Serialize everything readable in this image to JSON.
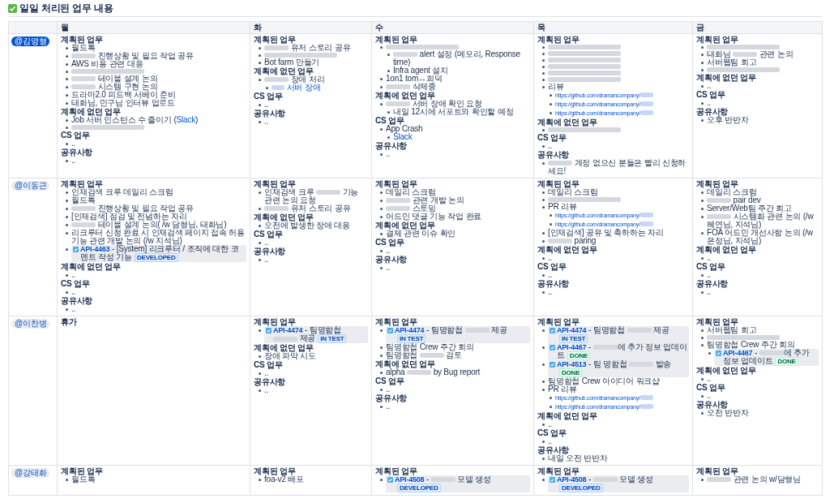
{
  "title": "일일 처리된 업무 내용",
  "columns": [
    "월",
    "화",
    "수",
    "목",
    "금"
  ],
  "rows": [
    {
      "user": {
        "name": "@김영형",
        "highlighted": true
      },
      "cells": [
        {
          "sections": [
            {
              "heading": "계획된 업무",
              "items": [
                {
                  "text": "월드톡"
                },
                {
                  "parts": [
                    {
                      "kind": "blur"
                    },
                    {
                      "kind": "text",
                      "text": " 진행상황 및 필요 작업 공유"
                    }
                  ]
                },
                {
                  "text": "AWS 비용 관련 대응"
                },
                {
                  "parts": [
                    {
                      "kind": "blur"
                    }
                  ]
                },
                {
                  "parts": [
                    {
                      "kind": "blur"
                    },
                    {
                      "kind": "text",
                      "text": " 테이블 설계 논의"
                    }
                  ]
                },
                {
                  "parts": [
                    {
                      "kind": "blur"
                    },
                    {
                      "kind": "text",
                      "text": " 시스템 구현 논의"
                    }
                  ]
                },
                {
                  "text": "드라마2.0 피드백 서베이 준비"
                },
                {
                  "text": "태화님, 민구님 인터뷰 업로드"
                }
              ]
            },
            {
              "heading": "계획에 없던 업무",
              "items": [
                {
                  "parts": [
                    {
                      "kind": "text",
                      "text": "Job 서버 인스턴스 수 줄이기 ("
                    },
                    {
                      "kind": "link",
                      "text": "Slack"
                    },
                    {
                      "kind": "text",
                      "text": ")"
                    }
                  ]
                },
                {
                  "parts": [
                    {
                      "kind": "blur"
                    }
                  ]
                }
              ]
            },
            {
              "heading": "CS 업무",
              "items": [
                {
                  "text": ".."
                }
              ]
            },
            {
              "heading": "공유사항",
              "items": [
                {
                  "text": ".."
                }
              ]
            }
          ]
        },
        {
          "sections": [
            {
              "heading": "계획된 업무",
              "items": [
                {
                  "parts": [
                    {
                      "kind": "blur"
                    },
                    {
                      "kind": "text",
                      "text": " 유저 스토리 공유"
                    }
                  ]
                },
                {
                  "parts": [
                    {
                      "kind": "blur"
                    }
                  ]
                },
                {
                  "text": "Bot farm 만들기"
                }
              ]
            },
            {
              "heading": "계획에 없던 업무",
              "items": [
                {
                  "parts": [
                    {
                      "kind": "blur"
                    },
                    {
                      "kind": "text",
                      "text": " 장애 처리"
                    }
                  ],
                  "children": [
                    {
                      "parts": [
                        {
                          "kind": "blurlink"
                        },
                        {
                          "kind": "link",
                          "text": " 서버 장애"
                        }
                      ]
                    }
                  ]
                }
              ]
            },
            {
              "heading": "CS 업무",
              "items": [
                {
                  "text": ".."
                }
              ]
            },
            {
              "heading": "공유사항",
              "items": [
                {
                  "text": ".."
                }
              ]
            }
          ]
        },
        {
          "sections": [
            {
              "heading": "계획된 업무",
              "items": [
                {
                  "parts": [
                    {
                      "kind": "blur"
                    }
                  ],
                  "children": [
                    {
                      "parts": [
                        {
                          "kind": "blur"
                        },
                        {
                          "kind": "text",
                          "text": " alert 설정 (메모리, Response time)"
                        }
                      ]
                    },
                    {
                      "text": "Infra agent 설치"
                    }
                  ]
                },
                {
                  "text": "1on1 tom↔희덕"
                },
                {
                  "parts": [
                    {
                      "kind": "blur"
                    },
                    {
                      "kind": "text",
                      "text": " 삭제중"
                    }
                  ]
                }
              ]
            },
            {
              "heading": "계획에 없던 업무",
              "items": [
                {
                  "parts": [
                    {
                      "kind": "blur"
                    },
                    {
                      "kind": "text",
                      "text": " 서버 장애 확인 요청"
                    }
                  ],
                  "children": [
                    {
                      "text": "내일 12시에 서포트와 확인할 예정"
                    }
                  ]
                }
              ]
            },
            {
              "heading": "CS 업무",
              "items": [
                {
                  "text": "App Crash",
                  "children": [
                    {
                      "parts": [
                        {
                          "kind": "link",
                          "text": "Slack"
                        }
                      ]
                    }
                  ]
                }
              ]
            },
            {
              "heading": "공유사항",
              "items": [
                {
                  "text": ".."
                }
              ]
            }
          ]
        },
        {
          "sections": [
            {
              "heading": "계획된 업무",
              "items": [
                {
                  "parts": [
                    {
                      "kind": "blur"
                    }
                  ]
                },
                {
                  "parts": [
                    {
                      "kind": "blur"
                    }
                  ]
                },
                {
                  "parts": [
                    {
                      "kind": "blur"
                    }
                  ]
                },
                {
                  "parts": [
                    {
                      "kind": "blur"
                    }
                  ]
                },
                {
                  "parts": [
                    {
                      "kind": "blur"
                    }
                  ]
                },
                {
                  "parts": [
                    {
                      "kind": "blur"
                    }
                  ]
                },
                {
                  "text": "리뷰",
                  "children": [
                    {
                      "parts": [
                        {
                          "kind": "link",
                          "text": "https://github.com/dramancompany/"
                        },
                        {
                          "kind": "blurlink"
                        }
                      ]
                    },
                    {
                      "parts": [
                        {
                          "kind": "link",
                          "text": "https://github.com/dramancompany/"
                        },
                        {
                          "kind": "blurlink"
                        }
                      ]
                    },
                    {
                      "parts": [
                        {
                          "kind": "link",
                          "text": "https://github.com/dramancompany/"
                        },
                        {
                          "kind": "blurlink"
                        }
                      ]
                    }
                  ]
                }
              ]
            },
            {
              "heading": "계획에 없던 업무",
              "items": [
                {
                  "parts": [
                    {
                      "kind": "blur"
                    }
                  ]
                }
              ]
            },
            {
              "heading": "CS 업무",
              "items": [
                {
                  "text": ".."
                }
              ]
            },
            {
              "heading": "공유사항",
              "items": [
                {
                  "parts": [
                    {
                      "kind": "blur"
                    },
                    {
                      "kind": "text",
                      "text": " 계정 없으신 분들은 빨리 신청하세요!"
                    }
                  ]
                }
              ]
            }
          ]
        },
        {
          "sections": [
            {
              "heading": "계획된 업무",
              "items": [
                {
                  "parts": [
                    {
                      "kind": "blur"
                    }
                  ]
                },
                {
                  "parts": [
                    {
                      "kind": "text",
                      "text": "태화님 "
                    },
                    {
                      "kind": "blur"
                    },
                    {
                      "kind": "text",
                      "text": " 관련 논의"
                    }
                  ]
                },
                {
                  "text": "서버웹팀 회고"
                },
                {
                  "parts": [
                    {
                      "kind": "blur"
                    }
                  ]
                }
              ]
            },
            {
              "heading": "계획에 없던 업무",
              "items": [
                {
                  "text": ".."
                }
              ]
            },
            {
              "heading": "CS 업무",
              "items": [
                {
                  "text": ".."
                }
              ]
            },
            {
              "heading": "공유사항",
              "items": [
                {
                  "text": "오후 반반차"
                }
              ]
            }
          ]
        }
      ]
    },
    {
      "user": {
        "name": "@이동근",
        "highlighted": false
      },
      "cells": [
        {
          "sections": [
            {
              "heading": "계획된 업무",
              "items": [
                {
                  "text": "인재검색 크루 데일리 스크럼"
                },
                {
                  "text": "월드톡"
                },
                {
                  "parts": [
                    {
                      "kind": "blur"
                    },
                    {
                      "kind": "text",
                      "text": " 진행상황 및 필요 작업 공유"
                    }
                  ]
                },
                {
                  "text": "[인재검색] 점검 및 전념하는 자리"
                },
                {
                  "parts": [
                    {
                      "kind": "blur"
                    },
                    {
                      "kind": "text",
                      "text": " 테이블 설계 논의( /w 담형님, 태화님)"
                    }
                  ]
                },
                {
                  "text": "리크루터 신청 완료 시 인재검색 페이지 접속 허용 기능 관련 개발 논의 (/w 지석님)"
                },
                {
                  "kind": "ticket",
                  "key": "API-4463",
                  "parts": [
                    {
                      "kind": "text",
                      "text": " - [System] 리크루터 / 조직에 대한 코멘트 작성 기능"
                    }
                  ],
                  "status": {
                    "label": "DEVELOPED",
                    "kind": "progress"
                  }
                }
              ]
            },
            {
              "heading": "계획에 없던 업무",
              "items": [
                {
                  "text": ".."
                }
              ]
            },
            {
              "heading": "CS 업무",
              "items": [
                {
                  "text": ".."
                }
              ]
            },
            {
              "heading": "공유사항",
              "items": [
                {
                  "text": ".."
                }
              ]
            }
          ]
        },
        {
          "sections": [
            {
              "heading": "계획된 업무",
              "items": [
                {
                  "parts": [
                    {
                      "kind": "text",
                      "text": "인재검색 크루 "
                    },
                    {
                      "kind": "blur"
                    },
                    {
                      "kind": "text",
                      "text": " 기능 관련 논의 요청"
                    }
                  ]
                },
                {
                  "parts": [
                    {
                      "kind": "blur"
                    },
                    {
                      "kind": "text",
                      "text": " 유저 스토리 공유"
                    }
                  ]
                }
              ]
            },
            {
              "heading": "계획에 없던 업무",
              "items": [
                {
                  "text": "오전에 발생한 장애 대응"
                }
              ]
            },
            {
              "heading": "CS 업무",
              "items": [
                {
                  "text": ".."
                }
              ]
            },
            {
              "heading": "공유사항",
              "items": [
                {
                  "text": ".."
                }
              ]
            }
          ]
        },
        {
          "sections": [
            {
              "heading": "계획된 업무",
              "items": [
                {
                  "text": "데일리 스크럼"
                },
                {
                  "parts": [
                    {
                      "kind": "blur"
                    },
                    {
                      "kind": "text",
                      "text": " 관련 개발 논의"
                    }
                  ]
                },
                {
                  "parts": [
                    {
                      "kind": "blur"
                    },
                    {
                      "kind": "text",
                      "text": " 스토밍"
                    }
                  ]
                },
                {
                  "text": "어드민 댓글 기능 작업 완료"
                }
              ]
            },
            {
              "heading": "계획에 없던 업무",
              "items": [
                {
                  "text": "결제 관련 이슈 확인"
                }
              ]
            },
            {
              "heading": "CS 업무",
              "items": [
                {
                  "text": ".."
                }
              ]
            },
            {
              "heading": "공유사항",
              "items": [
                {
                  "text": ".."
                }
              ]
            }
          ]
        },
        {
          "sections": [
            {
              "heading": "계획된 업무",
              "items": [
                {
                  "text": "데일리 스크럼"
                },
                {
                  "parts": [
                    {
                      "kind": "blur"
                    }
                  ]
                },
                {
                  "text": "PR 리뷰",
                  "children": [
                    {
                      "parts": [
                        {
                          "kind": "link",
                          "text": "https://github.com/dramancompany/"
                        },
                        {
                          "kind": "blurlink"
                        }
                      ]
                    },
                    {
                      "parts": [
                        {
                          "kind": "link",
                          "text": "https://github.com/dramancompany/"
                        },
                        {
                          "kind": "blurlink"
                        }
                      ]
                    }
                  ]
                },
                {
                  "text": "[인재검색] 공유 및 축하하는 자리"
                },
                {
                  "parts": [
                    {
                      "kind": "blur"
                    },
                    {
                      "kind": "text",
                      "text": " paring"
                    }
                  ]
                }
              ]
            },
            {
              "heading": "계획에 없던 업무",
              "items": [
                {
                  "text": ".."
                }
              ]
            },
            {
              "heading": "CS 업무",
              "items": [
                {
                  "text": ".."
                }
              ]
            },
            {
              "heading": "공유사항",
              "items": [
                {
                  "text": ".."
                }
              ]
            }
          ]
        },
        {
          "sections": [
            {
              "heading": "계획된 업무",
              "items": [
                {
                  "text": "데일리 스크럼"
                },
                {
                  "parts": [
                    {
                      "kind": "blur"
                    },
                    {
                      "kind": "text",
                      "text": " pair dev"
                    }
                  ]
                },
                {
                  "text": "Server/Web팀 주간 회고"
                },
                {
                  "parts": [
                    {
                      "kind": "blur"
                    },
                    {
                      "kind": "text",
                      "text": " 시스템화 관련 논의 (/w 혜연님, 지석님)"
                    }
                  ]
                },
                {
                  "text": "FOA 어드민 개선사항 논의 (/w 은정님, 지석님)"
                }
              ]
            },
            {
              "heading": "계획에 없던 업무",
              "items": [
                {
                  "text": ".."
                }
              ]
            },
            {
              "heading": "CS 업무",
              "items": [
                {
                  "text": ".."
                }
              ]
            },
            {
              "heading": "공유사항",
              "items": [
                {
                  "text": ".."
                }
              ]
            }
          ]
        }
      ]
    },
    {
      "user": {
        "name": "@이찬병",
        "highlighted": false
      },
      "cells": [
        {
          "sections": [
            {
              "heading": "휴가"
            }
          ]
        },
        {
          "sections": [
            {
              "heading": "계획된 업무",
              "items": [
                {
                  "kind": "ticket",
                  "key": "API-4474",
                  "parts": [
                    {
                      "kind": "text",
                      "text": " - 팀명함첩 "
                    },
                    {
                      "kind": "blur"
                    },
                    {
                      "kind": "text",
                      "text": " 제공"
                    }
                  ],
                  "status": {
                    "label": "IN TEST",
                    "kind": "progress"
                  }
                }
              ]
            },
            {
              "heading": "계획에 없던 업무",
              "items": [
                {
                  "text": "장애 파악 시도"
                }
              ]
            },
            {
              "heading": "CS 업무",
              "items": [
                {
                  "text": ".."
                }
              ]
            },
            {
              "heading": "공유사항",
              "items": [
                {
                  "text": ".."
                }
              ]
            }
          ]
        },
        {
          "sections": [
            {
              "heading": "계획된 업무",
              "items": [
                {
                  "kind": "ticket",
                  "key": "API-4474",
                  "parts": [
                    {
                      "kind": "text",
                      "text": " - 팀명함첩 "
                    },
                    {
                      "kind": "blur"
                    },
                    {
                      "kind": "text",
                      "text": " 제공"
                    }
                  ],
                  "status": {
                    "label": "IN TEST",
                    "kind": "progress"
                  }
                },
                {
                  "text": "팀명함첩 Crew 주간 회의"
                },
                {
                  "parts": [
                    {
                      "kind": "text",
                      "text": "팀명함첩 "
                    },
                    {
                      "kind": "blur"
                    },
                    {
                      "kind": "text",
                      "text": " 검토"
                    }
                  ]
                }
              ]
            },
            {
              "heading": "계획에 없던 업무",
              "items": [
                {
                  "parts": [
                    {
                      "kind": "text",
                      "text": "alpha "
                    },
                    {
                      "kind": "blur"
                    },
                    {
                      "kind": "text",
                      "text": " by Bug report"
                    }
                  ]
                }
              ]
            },
            {
              "heading": "CS 업무",
              "items": [
                {
                  "text": ".."
                }
              ]
            },
            {
              "heading": "공유사항",
              "items": [
                {
                  "text": ".."
                }
              ]
            }
          ]
        },
        {
          "sections": [
            {
              "heading": "계획된 업무",
              "items": [
                {
                  "kind": "ticket",
                  "key": "API-4474",
                  "parts": [
                    {
                      "kind": "text",
                      "text": " - 팀명함첩 "
                    },
                    {
                      "kind": "blur"
                    },
                    {
                      "kind": "text",
                      "text": " 제공"
                    }
                  ],
                  "status": {
                    "label": "IN TEST",
                    "kind": "progress"
                  }
                },
                {
                  "kind": "ticket",
                  "key": "API-4467",
                  "parts": [
                    {
                      "kind": "text",
                      "text": " - "
                    },
                    {
                      "kind": "blur"
                    },
                    {
                      "kind": "text",
                      "text": "에 추가 정보 업데이트"
                    }
                  ],
                  "status": {
                    "label": "DONE",
                    "kind": "success"
                  }
                },
                {
                  "kind": "ticket",
                  "key": "API-4513",
                  "parts": [
                    {
                      "kind": "text",
                      "text": " - 팀 명함첩 "
                    },
                    {
                      "kind": "blur"
                    },
                    {
                      "kind": "text",
                      "text": " 발송"
                    }
                  ],
                  "status": {
                    "label": "DONE",
                    "kind": "success"
                  }
                },
                {
                  "text": "팀명함첩 Crew 아이디어 워크샵"
                },
                {
                  "text": "PR 리뷰",
                  "children": [
                    {
                      "parts": [
                        {
                          "kind": "link",
                          "text": "https://github.com/dramancompany/"
                        },
                        {
                          "kind": "blurlink"
                        }
                      ]
                    },
                    {
                      "parts": [
                        {
                          "kind": "link",
                          "text": "https://github.com/dramancompany/"
                        },
                        {
                          "kind": "blurlink"
                        }
                      ]
                    }
                  ]
                }
              ]
            },
            {
              "heading": "계획에 없던 업무",
              "items": [
                {
                  "text": ".."
                }
              ]
            },
            {
              "heading": "CS 업무",
              "items": [
                {
                  "text": ".."
                }
              ]
            },
            {
              "heading": "공유사항",
              "items": [
                {
                  "text": "내일 오전 반반차"
                }
              ]
            }
          ]
        },
        {
          "sections": [
            {
              "heading": "계획된 업무",
              "items": [
                {
                  "text": "서버웹팀 회고"
                },
                {
                  "parts": [
                    {
                      "kind": "blur"
                    }
                  ]
                },
                {
                  "text": "팀명함첩 Crew 주간 회의",
                  "children": [
                    {
                      "kind": "ticket",
                      "key": "API-4467",
                      "parts": [
                        {
                          "kind": "text",
                          "text": " - "
                        },
                        {
                          "kind": "blur"
                        },
                        {
                          "kind": "text",
                          "text": "에 추가 정보 업데이트"
                        }
                      ],
                      "status": {
                        "label": "DONE",
                        "kind": "success"
                      }
                    }
                  ]
                }
              ]
            },
            {
              "heading": "계획에 없던 업무",
              "items": [
                {
                  "text": ".."
                }
              ]
            },
            {
              "heading": "CS 업무",
              "items": [
                {
                  "text": ".."
                }
              ]
            },
            {
              "heading": "공유사항",
              "items": [
                {
                  "text": "오전 반반차"
                }
              ]
            }
          ]
        }
      ]
    },
    {
      "user": {
        "name": "@강태화",
        "highlighted": false
      },
      "cells": [
        {
          "sections": [
            {
              "heading": "계획된 업무",
              "items": [
                {
                  "text": "월드톡"
                }
              ]
            }
          ]
        },
        {
          "sections": [
            {
              "heading": "계획된 업무",
              "items": [
                {
                  "text": "foa-v2 배포"
                }
              ]
            }
          ]
        },
        {
          "sections": [
            {
              "heading": "계획된 업무",
              "items": [
                {
                  "kind": "ticket",
                  "key": "API-4508",
                  "parts": [
                    {
                      "kind": "text",
                      "text": " - "
                    },
                    {
                      "kind": "blur"
                    },
                    {
                      "kind": "text",
                      "text": " 모델 생성"
                    }
                  ],
                  "status": {
                    "label": "DEVELOPED",
                    "kind": "progress"
                  }
                }
              ]
            }
          ]
        },
        {
          "sections": [
            {
              "heading": "계획된 업무",
              "items": [
                {
                  "kind": "ticket",
                  "key": "API-4508",
                  "parts": [
                    {
                      "kind": "text",
                      "text": " - "
                    },
                    {
                      "kind": "blur"
                    },
                    {
                      "kind": "text",
                      "text": " 모델 생성"
                    }
                  ],
                  "status": {
                    "label": "DEVELOPED",
                    "kind": "progress"
                  }
                }
              ]
            }
          ]
        },
        {
          "sections": [
            {
              "heading": "계획된 업무",
              "items": [
                {
                  "parts": [
                    {
                      "kind": "blur"
                    },
                    {
                      "kind": "text",
                      "text": " 관련 논의 w/담형님"
                    }
                  ]
                }
              ]
            }
          ]
        }
      ]
    }
  ]
}
